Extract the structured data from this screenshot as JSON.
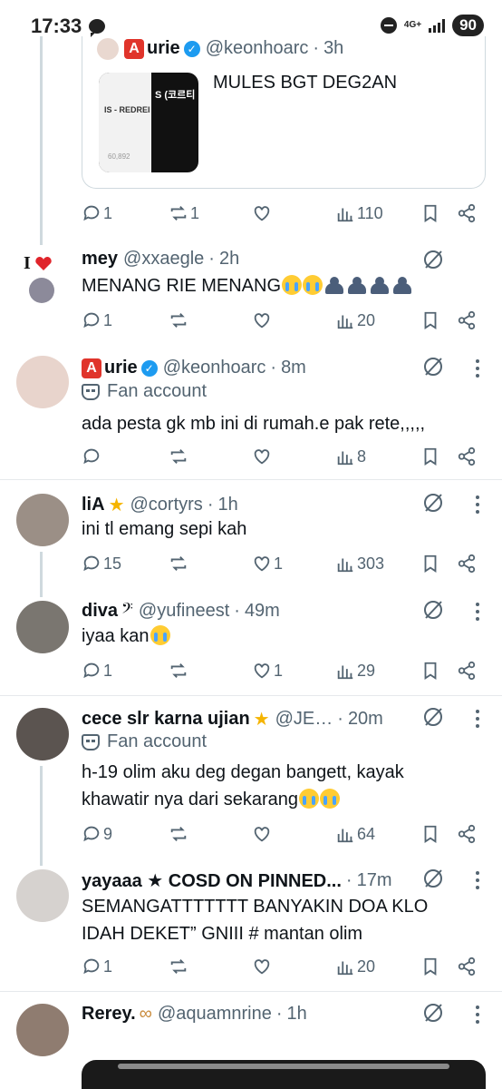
{
  "status_bar": {
    "time": "17:33",
    "network": "4G+",
    "battery": "90"
  },
  "quoted_tweet": {
    "display_name": "urie",
    "badge_letter": "A",
    "handle": "@keonhoarc",
    "age": "3h",
    "text": "MULES BGT DEG2AN",
    "thumb_left_text": "IS - REDREI",
    "thumb_right_text": "S (코르티",
    "thumb_count": "60,892",
    "actions": {
      "replies": "1",
      "reposts": "1",
      "likes": "",
      "views": "110"
    }
  },
  "tweets": [
    {
      "display_name": "mey",
      "handle": "@xxaegle",
      "age": "2h",
      "text": "MENANG RIE MENANG",
      "actions": {
        "replies": "1",
        "reposts": "",
        "likes": "",
        "views": "20"
      }
    },
    {
      "display_name": "urie",
      "badge_letter": "A",
      "handle": "@keonhoarc",
      "age": "8m",
      "fan_label": "Fan account",
      "text": "ada pesta gk mb ini di rumah.e pak rete,,,,,",
      "actions": {
        "replies": "",
        "reposts": "",
        "likes": "",
        "views": "8"
      }
    },
    {
      "display_name": "liA",
      "handle": "@cortyrs",
      "age": "1h",
      "text": "ini tl emang sepi kah",
      "actions": {
        "replies": "15",
        "reposts": "",
        "likes": "1",
        "views": "303"
      }
    },
    {
      "display_name": "diva",
      "handle": "@yufineest",
      "age": "49m",
      "text": "iyaa kan",
      "actions": {
        "replies": "1",
        "reposts": "",
        "likes": "1",
        "views": "29"
      }
    },
    {
      "display_name": "cece slr karna ujian",
      "handle": "@JE…",
      "age": "20m",
      "fan_label": "Fan account",
      "text": "h-19 olim aku deg degan bangett, kayak khawatir nya dari sekarang",
      "actions": {
        "replies": "9",
        "reposts": "",
        "likes": "",
        "views": "64"
      }
    },
    {
      "display_name": "yayaaa ★ COSD ON PINNED...",
      "handle": "",
      "age": "17m",
      "text": "SEMANGATTTTTTT BANYAKIN DOA KLO IDAH DEKET” GNIII # mantan olim",
      "actions": {
        "replies": "1",
        "reposts": "",
        "likes": "",
        "views": "20"
      }
    },
    {
      "display_name": "Rerey.",
      "handle": "@aquamnrine",
      "age": "1h",
      "text": "",
      "actions": {
        "replies": "",
        "reposts": "",
        "likes": "",
        "views": ""
      }
    }
  ]
}
